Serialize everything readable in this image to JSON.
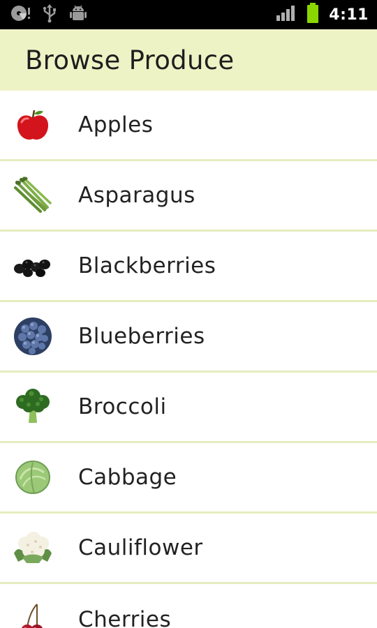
{
  "status_bar": {
    "time": "4:11",
    "left_icons": [
      "cd-icon",
      "usb-icon",
      "android-debug-icon"
    ],
    "right_icons": [
      "signal-icon",
      "battery-icon"
    ],
    "battery_color": "#8bd600"
  },
  "header": {
    "title": "Browse Produce",
    "background": "#eef3c6"
  },
  "produce": [
    {
      "label": "Apples",
      "icon": "apple-icon"
    },
    {
      "label": "Asparagus",
      "icon": "asparagus-icon"
    },
    {
      "label": "Blackberries",
      "icon": "blackberries-icon"
    },
    {
      "label": "Blueberries",
      "icon": "blueberries-icon"
    },
    {
      "label": "Broccoli",
      "icon": "broccoli-icon"
    },
    {
      "label": "Cabbage",
      "icon": "cabbage-icon"
    },
    {
      "label": "Cauliflower",
      "icon": "cauliflower-icon"
    },
    {
      "label": "Cherries",
      "icon": "cherries-icon"
    }
  ],
  "colors": {
    "divider": "#e4edbf",
    "text": "#222222"
  }
}
